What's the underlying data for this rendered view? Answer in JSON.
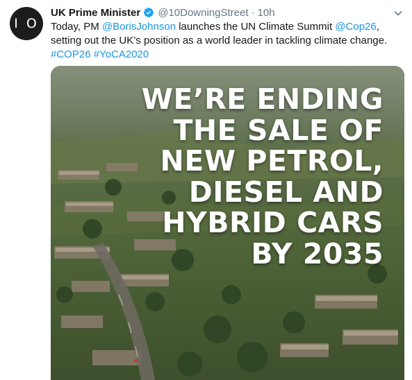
{
  "tweet": {
    "avatar_text": "I O",
    "author_name": "UK Prime Minister",
    "verified_icon": "verified-badge-icon",
    "handle": "@10DowningStreet",
    "separator": "·",
    "time": "10h",
    "caret_icon": "chevron-down-icon",
    "text": {
      "part1": "Today, PM ",
      "mention1": "@BorisJohnson",
      "part2": " launches the UN Climate Summit ",
      "mention2": "@Cop26",
      "part3": ",",
      "line2": "setting out the UK’s position as a world leader in tackling climate change.",
      "hashtag1": "#COP26",
      "hashtag2": "#YoCA2020"
    },
    "media": {
      "headline_lines": [
        "WE’RE ENDING",
        "THE SALE OF",
        "NEW PETROL,",
        "DIESEL AND",
        "HYBRID CARS",
        "BY 2035"
      ]
    }
  },
  "colors": {
    "link": "#1b95e0",
    "verified": "#1da1f2",
    "secondary_text": "#657786",
    "primary_text": "#14171a"
  }
}
